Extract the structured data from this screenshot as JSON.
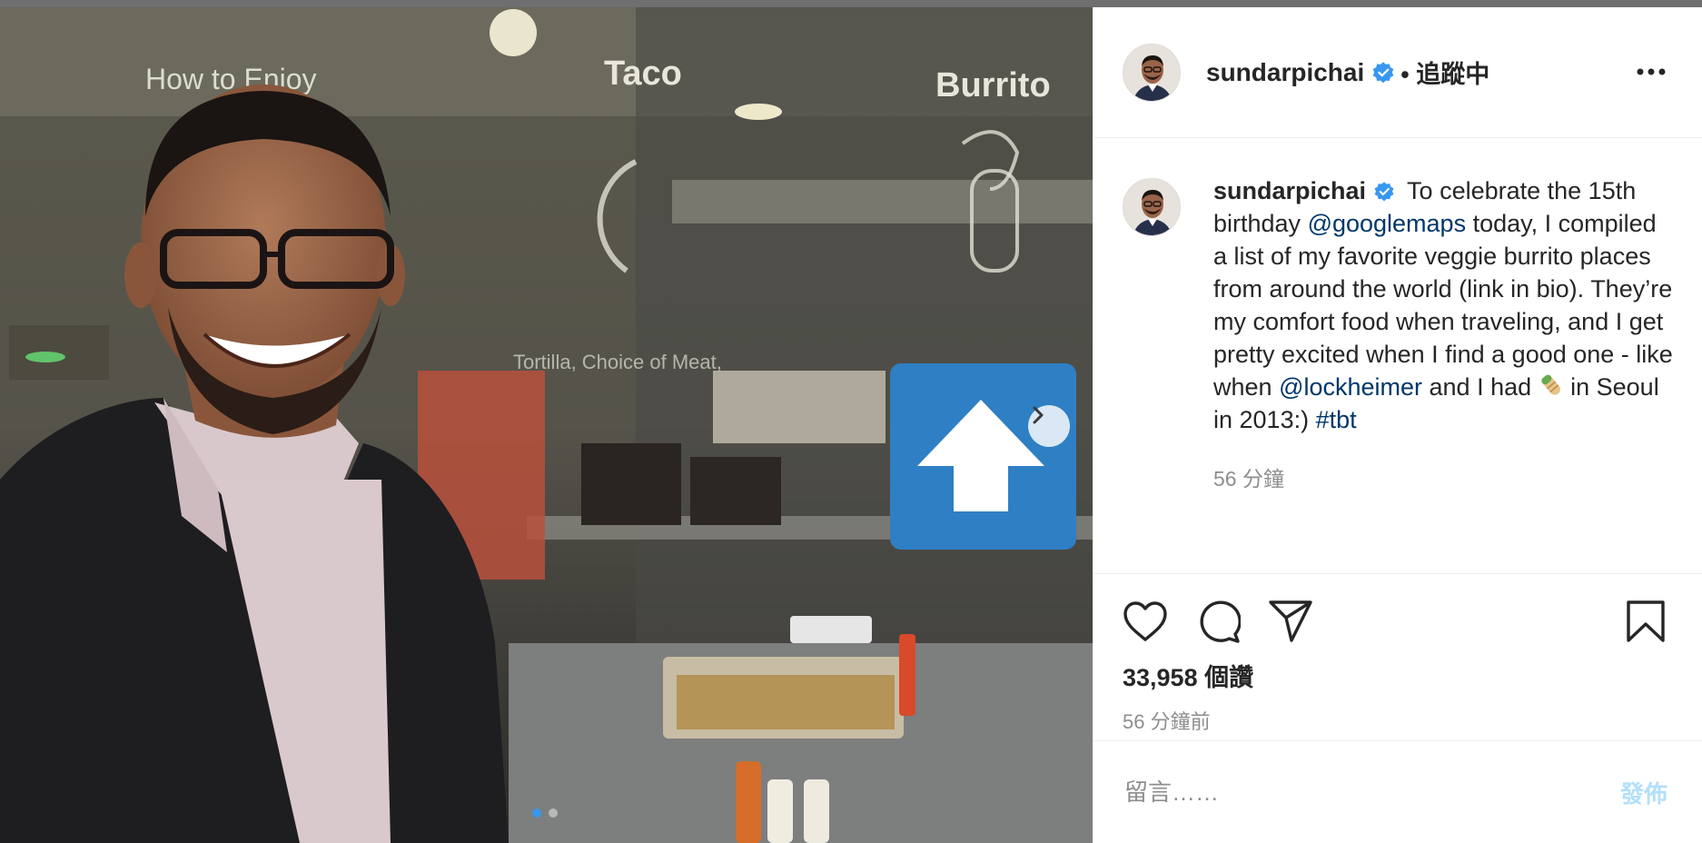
{
  "post": {
    "username": "sundarpichai",
    "follow_state": "• 追蹤中",
    "caption_username": "sundarpichai",
    "caption": {
      "part1": " To celebrate the 15th birthday ",
      "mention1": "@googlemaps",
      "part2": " today, I compiled a list of my favorite veggie burrito places from around the world (link in bio). They’re my comfort food when traveling, and I get pretty excited when I find a good one - like when ",
      "mention2": "@lockheimer",
      "part3": " and I had ",
      "part4": "  in Seoul in 2013:) ",
      "hashtag": "#tbt"
    },
    "caption_time": "56 分鐘",
    "likes": "33,958 個讚",
    "posted_time": "56 分鐘前",
    "comment_placeholder": "留言……",
    "post_button": "發佈"
  },
  "media": {
    "signs": {
      "taco": "Taco",
      "burrito": "Burrito",
      "how_to": "How to Enjoy",
      "tortilla": "Tortilla, Choice of Meat,"
    },
    "carousel": {
      "count": 2,
      "active": 1
    }
  },
  "icons": {
    "verified": "verified-badge-icon",
    "more": "more-options-icon",
    "like": "heart-icon",
    "comment": "comment-icon",
    "share": "paper-plane-icon",
    "save": "bookmark-icon",
    "next": "chevron-right-icon",
    "emoji": "burrito-emoji-icon"
  },
  "colors": {
    "accent": "#3897f0",
    "link": "#00376b",
    "muted": "#8e8e8e",
    "post_disabled": "#b2dffc",
    "arrow_sign": "#2f7fc4"
  }
}
